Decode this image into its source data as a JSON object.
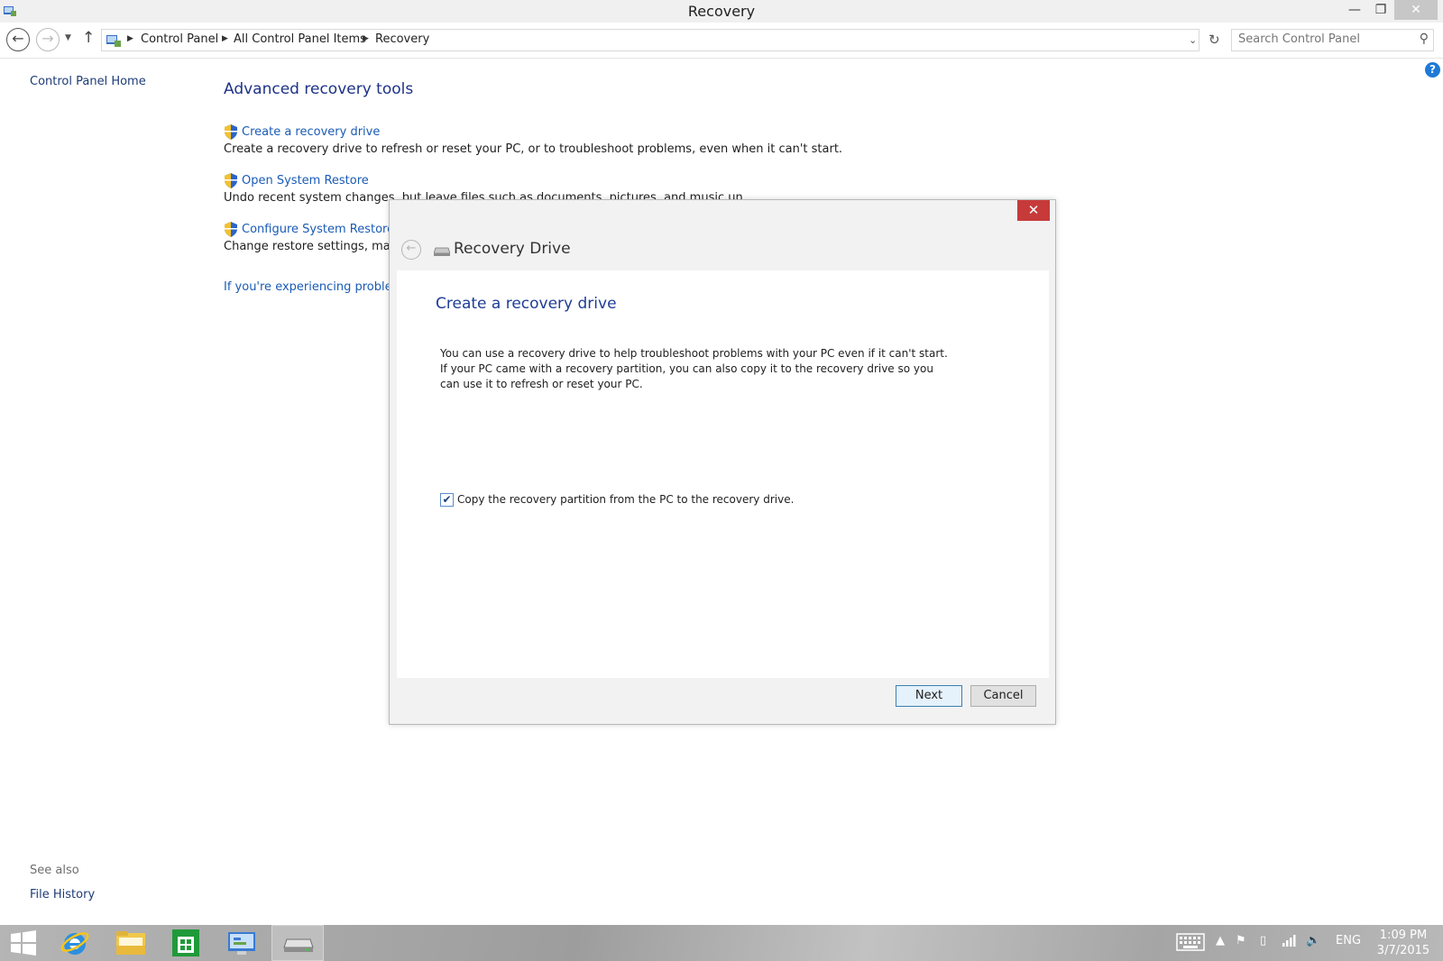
{
  "window": {
    "title": "Recovery"
  },
  "window_controls": {
    "minimize": "—",
    "maximize": "❐",
    "close": "✕"
  },
  "address_bar": {
    "crumbs": [
      "Control Panel",
      "All Control Panel Items",
      "Recovery"
    ]
  },
  "search": {
    "placeholder": "Search Control Panel"
  },
  "left_pane": {
    "home_link": "Control Panel Home",
    "see_also_label": "See also",
    "file_history": "File History"
  },
  "main": {
    "heading": "Advanced recovery tools",
    "tools": [
      {
        "label": "Create a recovery drive",
        "description": "Create a recovery drive to refresh or reset your PC, or to troubleshoot problems, even when it can't start."
      },
      {
        "label": "Open System Restore",
        "description": "Undo recent system changes, but leave files such as documents, pictures, and music unchanged."
      },
      {
        "label": "Configure System Restore",
        "description": "Change restore settings, manage disk space, and create or delete restore points."
      }
    ],
    "trouble_link": "If you're experiencing problems with your PC"
  },
  "dialog": {
    "title": "Recovery Drive",
    "heading": "Create a recovery drive",
    "body_text": "You can use a recovery drive to help troubleshoot problems with your PC even if it can't start. If your PC came with a recovery partition, you can also copy it to the recovery drive so you can use it to refresh or reset your PC.",
    "checkbox_label": "Copy the recovery partition from the PC to the recovery drive.",
    "checkbox_checked": true,
    "next_label": "Next",
    "cancel_label": "Cancel"
  },
  "taskbar": {
    "language": "ENG",
    "time": "1:09 PM",
    "date": "3/7/2015"
  },
  "colors": {
    "link": "#1a5bb5",
    "heading": "#1e3287",
    "dialog_close": "#c73a3a",
    "taskbar": "#a9a9a9"
  }
}
